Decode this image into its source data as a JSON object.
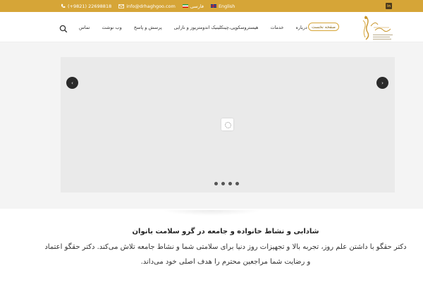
{
  "topbar": {
    "phone": "(+9821) 22698818",
    "email": "info@drhaghgoo.com",
    "lang_fa": "فارسی",
    "lang_en": "English",
    "linkedin_label": "in"
  },
  "nav": {
    "home_button": "صفحه نخست",
    "items": [
      "درباره",
      "خدمات",
      "هیستروسکوپی،چینکلینیک اندومتریوز و نازایی",
      "پرسش و پاسخ",
      "وب نوشت",
      "تماس"
    ]
  },
  "slider": {
    "prev_glyph": "‹",
    "next_glyph": "›",
    "dot_count": 4
  },
  "intro": {
    "heading": "شادابی و نشاط خانواده و جامعه در گرو سلامت بانوان",
    "body": "دکتر حقگو با داشتن علم روز، تجربه بالا و تجهیزات روز دنیا برای سلامتی شما و نشاط جامعه تلاش می‌کند. دکتر حقگو اعتماد و رضایت شما مراجعین محترم را هدف اصلی خود می‌داند."
  },
  "colors": {
    "brand_gold": "#d6a537",
    "slider_bg": "#eaeaea",
    "arrow_bg": "#2b2b2b"
  },
  "icons": [
    "phone-icon",
    "mail-icon",
    "flag-iran-icon",
    "flag-uk-icon",
    "linkedin-icon",
    "search-icon",
    "loader-icon"
  ]
}
